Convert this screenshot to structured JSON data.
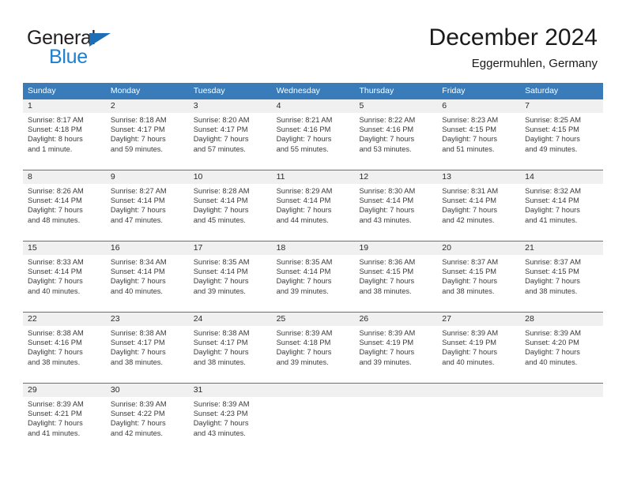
{
  "logo": {
    "word1": "General",
    "word2": "Blue",
    "triangle_color": "#1c6fb5",
    "blue_color": "#1c7fd0"
  },
  "header": {
    "title": "December 2024",
    "subtitle": "Eggermuhlen, Germany"
  },
  "theme": {
    "header_blue": "#3a7cb9",
    "daynum_bg": "#f0f0f0",
    "text": "#3a3a3a"
  },
  "weekdays": [
    "Sunday",
    "Monday",
    "Tuesday",
    "Wednesday",
    "Thursday",
    "Friday",
    "Saturday"
  ],
  "weeks": [
    [
      {
        "day": "1",
        "sunrise": "Sunrise: 8:17 AM",
        "sunset": "Sunset: 4:18 PM",
        "daylight1": "Daylight: 8 hours",
        "daylight2": "and 1 minute."
      },
      {
        "day": "2",
        "sunrise": "Sunrise: 8:18 AM",
        "sunset": "Sunset: 4:17 PM",
        "daylight1": "Daylight: 7 hours",
        "daylight2": "and 59 minutes."
      },
      {
        "day": "3",
        "sunrise": "Sunrise: 8:20 AM",
        "sunset": "Sunset: 4:17 PM",
        "daylight1": "Daylight: 7 hours",
        "daylight2": "and 57 minutes."
      },
      {
        "day": "4",
        "sunrise": "Sunrise: 8:21 AM",
        "sunset": "Sunset: 4:16 PM",
        "daylight1": "Daylight: 7 hours",
        "daylight2": "and 55 minutes."
      },
      {
        "day": "5",
        "sunrise": "Sunrise: 8:22 AM",
        "sunset": "Sunset: 4:16 PM",
        "daylight1": "Daylight: 7 hours",
        "daylight2": "and 53 minutes."
      },
      {
        "day": "6",
        "sunrise": "Sunrise: 8:23 AM",
        "sunset": "Sunset: 4:15 PM",
        "daylight1": "Daylight: 7 hours",
        "daylight2": "and 51 minutes."
      },
      {
        "day": "7",
        "sunrise": "Sunrise: 8:25 AM",
        "sunset": "Sunset: 4:15 PM",
        "daylight1": "Daylight: 7 hours",
        "daylight2": "and 49 minutes."
      }
    ],
    [
      {
        "day": "8",
        "sunrise": "Sunrise: 8:26 AM",
        "sunset": "Sunset: 4:14 PM",
        "daylight1": "Daylight: 7 hours",
        "daylight2": "and 48 minutes."
      },
      {
        "day": "9",
        "sunrise": "Sunrise: 8:27 AM",
        "sunset": "Sunset: 4:14 PM",
        "daylight1": "Daylight: 7 hours",
        "daylight2": "and 47 minutes."
      },
      {
        "day": "10",
        "sunrise": "Sunrise: 8:28 AM",
        "sunset": "Sunset: 4:14 PM",
        "daylight1": "Daylight: 7 hours",
        "daylight2": "and 45 minutes."
      },
      {
        "day": "11",
        "sunrise": "Sunrise: 8:29 AM",
        "sunset": "Sunset: 4:14 PM",
        "daylight1": "Daylight: 7 hours",
        "daylight2": "and 44 minutes."
      },
      {
        "day": "12",
        "sunrise": "Sunrise: 8:30 AM",
        "sunset": "Sunset: 4:14 PM",
        "daylight1": "Daylight: 7 hours",
        "daylight2": "and 43 minutes."
      },
      {
        "day": "13",
        "sunrise": "Sunrise: 8:31 AM",
        "sunset": "Sunset: 4:14 PM",
        "daylight1": "Daylight: 7 hours",
        "daylight2": "and 42 minutes."
      },
      {
        "day": "14",
        "sunrise": "Sunrise: 8:32 AM",
        "sunset": "Sunset: 4:14 PM",
        "daylight1": "Daylight: 7 hours",
        "daylight2": "and 41 minutes."
      }
    ],
    [
      {
        "day": "15",
        "sunrise": "Sunrise: 8:33 AM",
        "sunset": "Sunset: 4:14 PM",
        "daylight1": "Daylight: 7 hours",
        "daylight2": "and 40 minutes."
      },
      {
        "day": "16",
        "sunrise": "Sunrise: 8:34 AM",
        "sunset": "Sunset: 4:14 PM",
        "daylight1": "Daylight: 7 hours",
        "daylight2": "and 40 minutes."
      },
      {
        "day": "17",
        "sunrise": "Sunrise: 8:35 AM",
        "sunset": "Sunset: 4:14 PM",
        "daylight1": "Daylight: 7 hours",
        "daylight2": "and 39 minutes."
      },
      {
        "day": "18",
        "sunrise": "Sunrise: 8:35 AM",
        "sunset": "Sunset: 4:14 PM",
        "daylight1": "Daylight: 7 hours",
        "daylight2": "and 39 minutes."
      },
      {
        "day": "19",
        "sunrise": "Sunrise: 8:36 AM",
        "sunset": "Sunset: 4:15 PM",
        "daylight1": "Daylight: 7 hours",
        "daylight2": "and 38 minutes."
      },
      {
        "day": "20",
        "sunrise": "Sunrise: 8:37 AM",
        "sunset": "Sunset: 4:15 PM",
        "daylight1": "Daylight: 7 hours",
        "daylight2": "and 38 minutes."
      },
      {
        "day": "21",
        "sunrise": "Sunrise: 8:37 AM",
        "sunset": "Sunset: 4:15 PM",
        "daylight1": "Daylight: 7 hours",
        "daylight2": "and 38 minutes."
      }
    ],
    [
      {
        "day": "22",
        "sunrise": "Sunrise: 8:38 AM",
        "sunset": "Sunset: 4:16 PM",
        "daylight1": "Daylight: 7 hours",
        "daylight2": "and 38 minutes."
      },
      {
        "day": "23",
        "sunrise": "Sunrise: 8:38 AM",
        "sunset": "Sunset: 4:17 PM",
        "daylight1": "Daylight: 7 hours",
        "daylight2": "and 38 minutes."
      },
      {
        "day": "24",
        "sunrise": "Sunrise: 8:38 AM",
        "sunset": "Sunset: 4:17 PM",
        "daylight1": "Daylight: 7 hours",
        "daylight2": "and 38 minutes."
      },
      {
        "day": "25",
        "sunrise": "Sunrise: 8:39 AM",
        "sunset": "Sunset: 4:18 PM",
        "daylight1": "Daylight: 7 hours",
        "daylight2": "and 39 minutes."
      },
      {
        "day": "26",
        "sunrise": "Sunrise: 8:39 AM",
        "sunset": "Sunset: 4:19 PM",
        "daylight1": "Daylight: 7 hours",
        "daylight2": "and 39 minutes."
      },
      {
        "day": "27",
        "sunrise": "Sunrise: 8:39 AM",
        "sunset": "Sunset: 4:19 PM",
        "daylight1": "Daylight: 7 hours",
        "daylight2": "and 40 minutes."
      },
      {
        "day": "28",
        "sunrise": "Sunrise: 8:39 AM",
        "sunset": "Sunset: 4:20 PM",
        "daylight1": "Daylight: 7 hours",
        "daylight2": "and 40 minutes."
      }
    ],
    [
      {
        "day": "29",
        "sunrise": "Sunrise: 8:39 AM",
        "sunset": "Sunset: 4:21 PM",
        "daylight1": "Daylight: 7 hours",
        "daylight2": "and 41 minutes."
      },
      {
        "day": "30",
        "sunrise": "Sunrise: 8:39 AM",
        "sunset": "Sunset: 4:22 PM",
        "daylight1": "Daylight: 7 hours",
        "daylight2": "and 42 minutes."
      },
      {
        "day": "31",
        "sunrise": "Sunrise: 8:39 AM",
        "sunset": "Sunset: 4:23 PM",
        "daylight1": "Daylight: 7 hours",
        "daylight2": "and 43 minutes."
      },
      {
        "day": "",
        "sunrise": "",
        "sunset": "",
        "daylight1": "",
        "daylight2": ""
      },
      {
        "day": "",
        "sunrise": "",
        "sunset": "",
        "daylight1": "",
        "daylight2": ""
      },
      {
        "day": "",
        "sunrise": "",
        "sunset": "",
        "daylight1": "",
        "daylight2": ""
      },
      {
        "day": "",
        "sunrise": "",
        "sunset": "",
        "daylight1": "",
        "daylight2": ""
      }
    ]
  ]
}
